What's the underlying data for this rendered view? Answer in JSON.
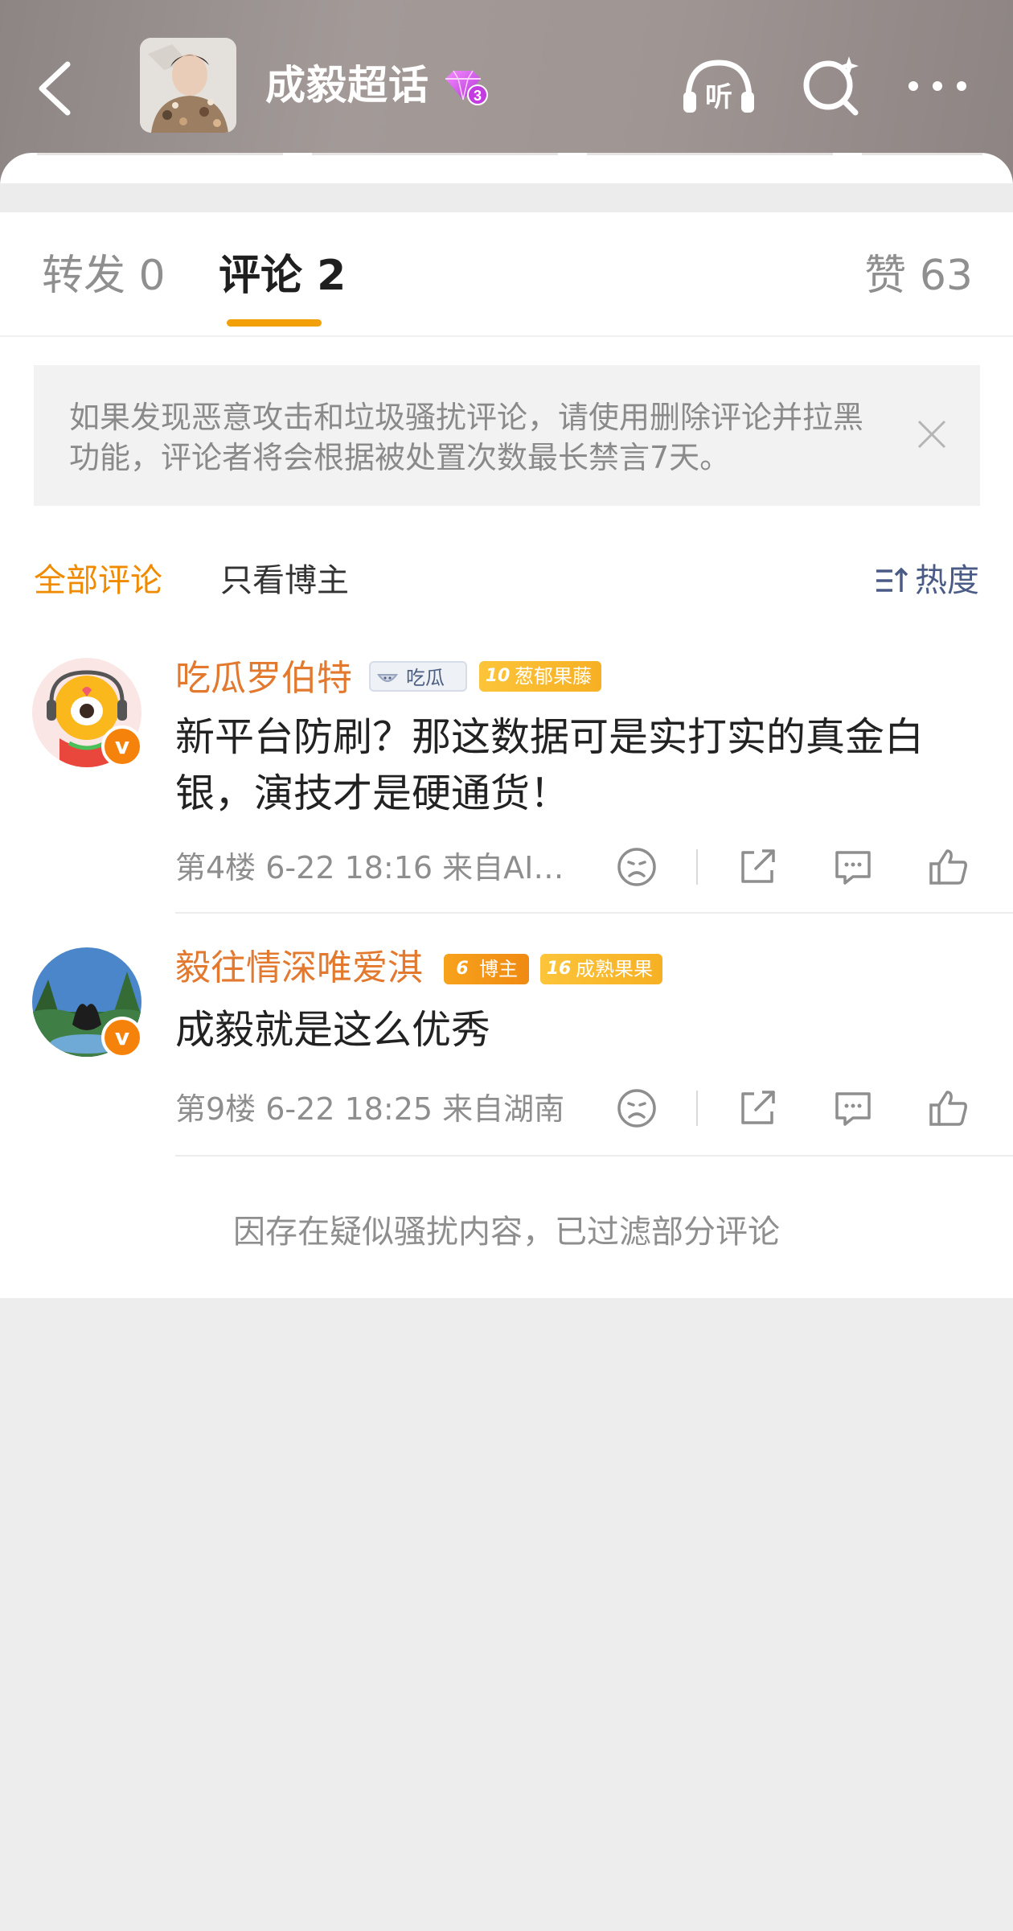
{
  "header": {
    "title": "成毅超话",
    "level_badge": "3",
    "back_icon": "chevron-left-icon",
    "listen_label": "听",
    "search_icon": "search-sparkle-icon",
    "more_icon": "more-dots-icon"
  },
  "tabs": {
    "repost": "转发 0",
    "comment": "评论 2",
    "like": "赞 63"
  },
  "notice": {
    "text": "如果发现恶意攻击和垃圾骚扰评论，请使用删除评论并拉黑功能，评论者将会根据被处置次数最长禁言7天。"
  },
  "filters": {
    "all": "全部评论",
    "blogger_only": "只看博主",
    "sort": "热度"
  },
  "comments": [
    {
      "name": "吃瓜罗伯特",
      "tag_melon": "吃瓜",
      "fan_level": "10",
      "fan_title": "葱郁果藤",
      "text": "新平台防刷？那这数据可是实打实的真金白银，演技才是硬通货！",
      "meta": "第4楼  6-22 18:16  来自AI…"
    },
    {
      "name": "毅往情深唯爱淇",
      "role_level": "6",
      "role_title": "博主",
      "fan_level": "16",
      "fan_title": "成熟果果",
      "text": "成毅就是这么优秀",
      "meta": "第9楼  6-22 18:25  来自湖南"
    }
  ],
  "verified_mark": "v",
  "footer_note": "因存在疑似骚扰内容，已过滤部分评论",
  "colors": {
    "accent_orange": "#f08a00",
    "tab_underline": "#f2a007",
    "username": "#e2792f",
    "sort_blue": "#4a5c86"
  }
}
